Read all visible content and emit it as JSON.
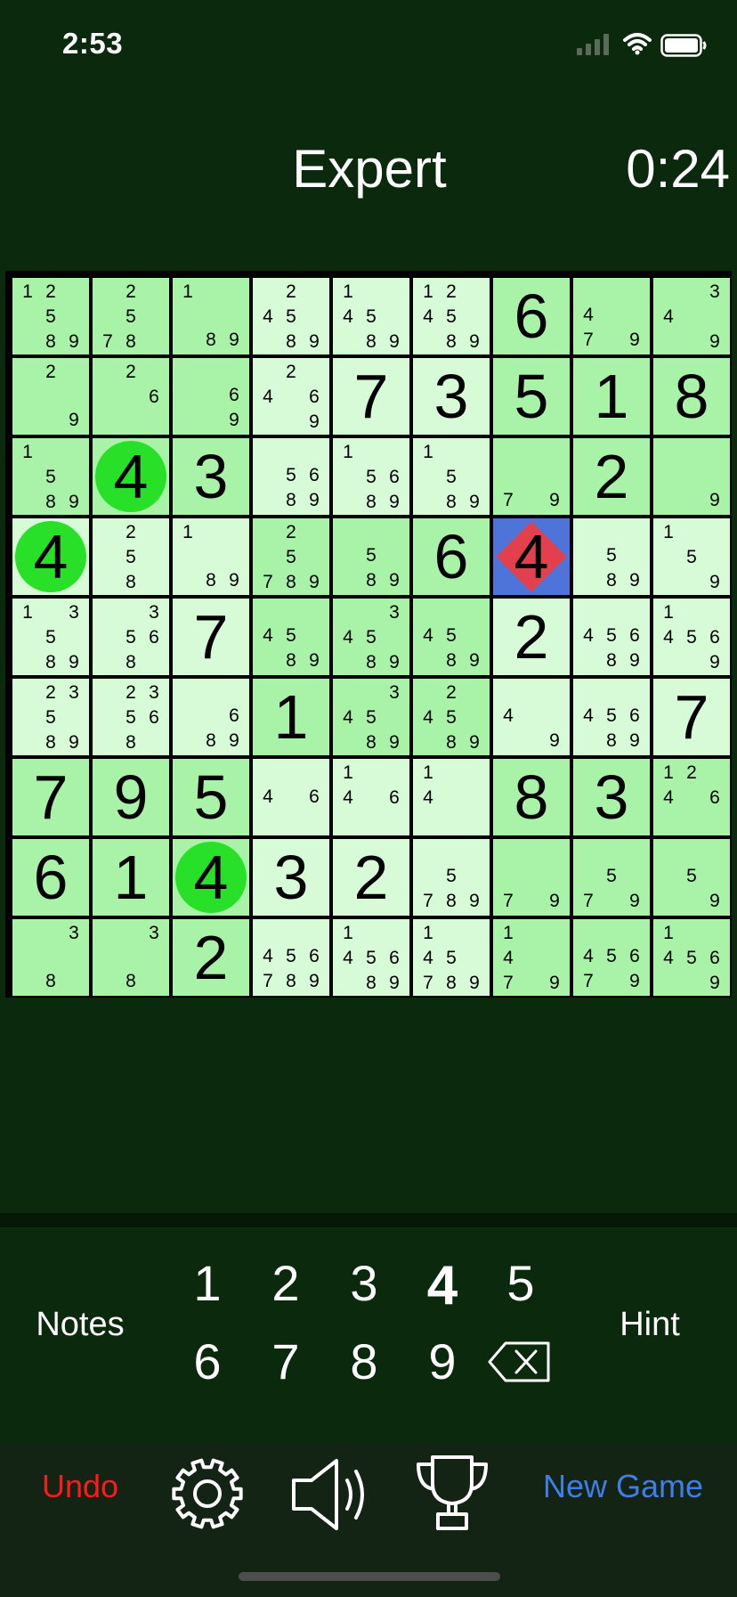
{
  "status_bar": {
    "time": "2:53"
  },
  "header": {
    "difficulty": "Expert",
    "timer": "0:24"
  },
  "board": {
    "grid": [
      [
        {
          "notes": [
            1,
            2,
            5,
            8,
            9
          ]
        },
        {
          "notes": [
            2,
            5,
            7,
            8
          ]
        },
        {
          "notes": [
            1,
            8,
            9
          ]
        },
        {
          "notes": [
            2,
            4,
            5,
            8,
            9
          ]
        },
        {
          "notes": [
            1,
            4,
            5,
            8,
            9
          ]
        },
        {
          "notes": [
            1,
            2,
            4,
            5,
            8,
            9
          ]
        },
        {
          "value": 6
        },
        {
          "notes": [
            4,
            7,
            9
          ]
        },
        {
          "notes": [
            3,
            4,
            9
          ]
        }
      ],
      [
        {
          "notes": [
            2,
            9
          ]
        },
        {
          "notes": [
            2,
            6
          ]
        },
        {
          "notes": [
            6,
            9
          ]
        },
        {
          "notes": [
            2,
            4,
            6,
            9
          ]
        },
        {
          "value": 7
        },
        {
          "value": 3
        },
        {
          "value": 5
        },
        {
          "value": 1
        },
        {
          "value": 8
        }
      ],
      [
        {
          "notes": [
            1,
            5,
            8,
            9
          ]
        },
        {
          "value": 4,
          "highlight": "circle"
        },
        {
          "value": 3
        },
        {
          "notes": [
            5,
            6,
            8,
            9
          ]
        },
        {
          "notes": [
            1,
            5,
            6,
            8,
            9
          ]
        },
        {
          "notes": [
            1,
            5,
            8,
            9
          ]
        },
        {
          "notes": [
            7,
            9
          ]
        },
        {
          "value": 2
        },
        {
          "notes": [
            9
          ]
        }
      ],
      [
        {
          "value": 4,
          "highlight": "circle"
        },
        {
          "notes": [
            2,
            5,
            8
          ]
        },
        {
          "notes": [
            1,
            8,
            9
          ]
        },
        {
          "notes": [
            2,
            5,
            7,
            8,
            9
          ]
        },
        {
          "notes": [
            5,
            8,
            9
          ]
        },
        {
          "value": 6
        },
        {
          "value": 4,
          "highlight": "diamond",
          "selected": true
        },
        {
          "notes": [
            5,
            8,
            9
          ]
        },
        {
          "notes": [
            1,
            5,
            9
          ]
        }
      ],
      [
        {
          "notes": [
            1,
            3,
            5,
            8,
            9
          ]
        },
        {
          "notes": [
            3,
            5,
            6,
            8
          ]
        },
        {
          "value": 7
        },
        {
          "notes": [
            4,
            5,
            8,
            9
          ]
        },
        {
          "notes": [
            3,
            4,
            5,
            8,
            9
          ]
        },
        {
          "notes": [
            4,
            5,
            8,
            9
          ]
        },
        {
          "value": 2
        },
        {
          "notes": [
            4,
            5,
            6,
            8,
            9
          ]
        },
        {
          "notes": [
            1,
            4,
            5,
            6,
            9
          ]
        }
      ],
      [
        {
          "notes": [
            2,
            3,
            5,
            8,
            9
          ]
        },
        {
          "notes": [
            2,
            3,
            5,
            6,
            8
          ]
        },
        {
          "notes": [
            6,
            8,
            9
          ]
        },
        {
          "value": 1
        },
        {
          "notes": [
            3,
            4,
            5,
            8,
            9
          ]
        },
        {
          "notes": [
            2,
            4,
            5,
            8,
            9
          ]
        },
        {
          "notes": [
            4,
            9
          ]
        },
        {
          "notes": [
            4,
            5,
            6,
            8,
            9
          ]
        },
        {
          "value": 7
        }
      ],
      [
        {
          "value": 7
        },
        {
          "value": 9
        },
        {
          "value": 5
        },
        {
          "notes": [
            4,
            6
          ]
        },
        {
          "notes": [
            1,
            4,
            6
          ]
        },
        {
          "notes": [
            1,
            4
          ]
        },
        {
          "value": 8
        },
        {
          "value": 3
        },
        {
          "notes": [
            1,
            2,
            4,
            6
          ]
        }
      ],
      [
        {
          "value": 6
        },
        {
          "value": 1
        },
        {
          "value": 4,
          "highlight": "circle"
        },
        {
          "value": 3
        },
        {
          "value": 2
        },
        {
          "notes": [
            5,
            7,
            8,
            9
          ]
        },
        {
          "notes": [
            7,
            9
          ]
        },
        {
          "notes": [
            5,
            7,
            9
          ]
        },
        {
          "notes": [
            5,
            9
          ]
        }
      ],
      [
        {
          "notes": [
            3,
            8
          ]
        },
        {
          "notes": [
            3,
            8
          ]
        },
        {
          "value": 2
        },
        {
          "notes": [
            4,
            5,
            6,
            7,
            8,
            9
          ]
        },
        {
          "notes": [
            1,
            4,
            5,
            6,
            8,
            9
          ]
        },
        {
          "notes": [
            1,
            4,
            5,
            7,
            8,
            9
          ]
        },
        {
          "notes": [
            1,
            4,
            7,
            9
          ]
        },
        {
          "notes": [
            4,
            5,
            6,
            7,
            9
          ]
        },
        {
          "notes": [
            1,
            4,
            5,
            6,
            9
          ]
        }
      ]
    ],
    "colors": {
      "light": "#d7fbd7",
      "dark": "#a9f3a9",
      "selected": "#4f74d9",
      "circle": "#27e027",
      "diamond": "#e2404c"
    }
  },
  "controls": {
    "notes_label": "Notes",
    "hint_label": "Hint",
    "keypad": [
      "1",
      "2",
      "3",
      "4",
      "5",
      "6",
      "7",
      "8",
      "9"
    ],
    "active_digit": "4"
  },
  "toolbar": {
    "undo_label": "Undo",
    "new_game_label": "New Game",
    "icons": [
      "gear-icon",
      "speaker-icon",
      "trophy-icon"
    ]
  }
}
